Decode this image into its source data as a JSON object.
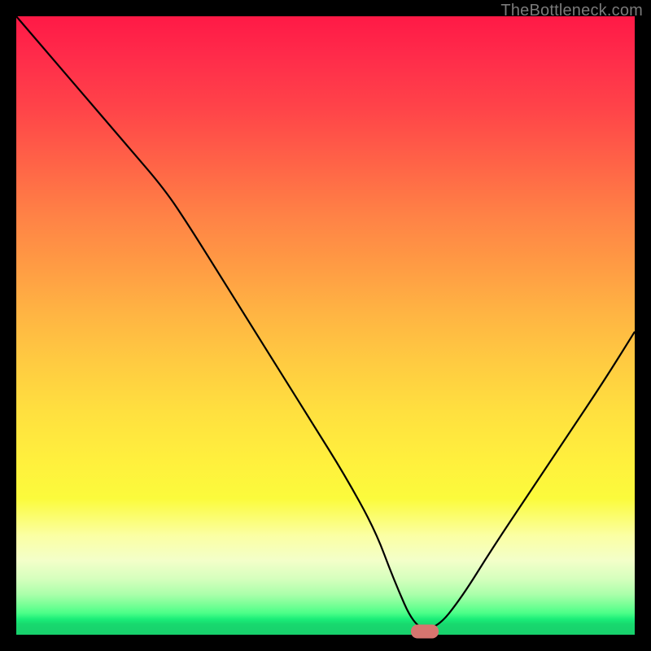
{
  "watermark": "TheBottleneck.com",
  "colors": {
    "marker": "#d6756f",
    "curve": "#000000",
    "gradient_top": "#ff1946",
    "gradient_bottom": "#17d06c"
  },
  "chart_data": {
    "type": "line",
    "title": "",
    "xlabel": "",
    "ylabel": "",
    "xlim": [
      0,
      100
    ],
    "ylim": [
      0,
      100
    ],
    "grid": false,
    "legend": false,
    "note": "Values are approximate, read from pixels. X is normalized horizontal position (0 left edge of plot, 100 right edge). Y is normalized vertical position (0 bottom green baseline, 100 top red).",
    "series": [
      {
        "name": "bottleneck-curve",
        "x": [
          0,
          6,
          12,
          18,
          24,
          28,
          33,
          38,
          43,
          48,
          53,
          58,
          61,
          64.5,
          68,
          72,
          77,
          83,
          89,
          95,
          100
        ],
        "y": [
          100,
          93,
          86,
          79,
          72,
          66,
          58,
          50,
          42,
          34,
          26,
          17,
          9,
          1,
          1,
          6,
          14,
          23,
          32,
          41,
          49
        ]
      }
    ],
    "marker": {
      "x": 66,
      "y": 0.5,
      "shape": "rounded-bar"
    }
  }
}
